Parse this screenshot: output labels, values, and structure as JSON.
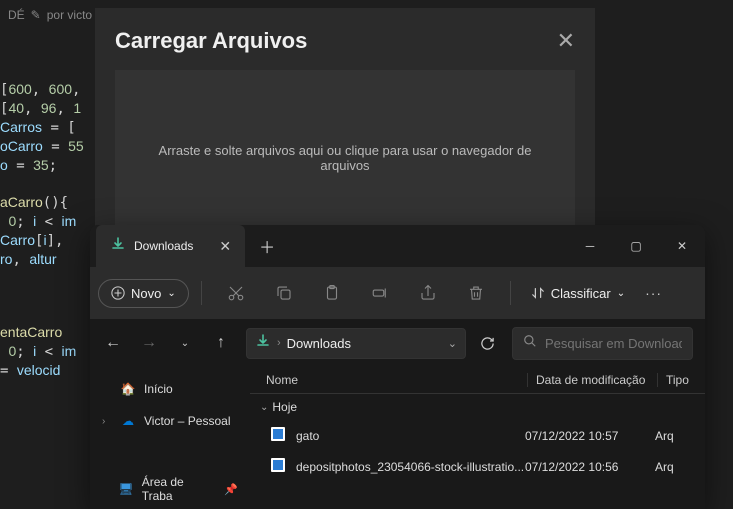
{
  "code_tab": {
    "prefix": "DÉ",
    "by": "por victo"
  },
  "code": "[600, 600, ...\n[40, 96, 1...\nCarros = [...\noCarro = 55...\no = 35;\n\naCarro(){  \n 0; i < im...\nCarro[i],...\nro, altur...\n\n\n\nentaCarro...\n 0; i < im...\n= velocida...",
  "upload": {
    "title": "Carregar Arquivos",
    "drop_text": "Arraste e solte arquivos aqui ou clique para usar o navegador de arquivos"
  },
  "explorer": {
    "tab_label": "Downloads",
    "new_label": "Novo",
    "sort_label": "Classificar",
    "addr_label": "Downloads",
    "search_placeholder": "Pesquisar em Downloads",
    "sidebar": {
      "home": "Início",
      "personal": "Victor – Pessoal",
      "desktop": "Área de Traba"
    },
    "columns": {
      "name": "Nome",
      "date": "Data de modificação",
      "type": "Tipo"
    },
    "group": "Hoje",
    "files": [
      {
        "name": "gato",
        "date": "07/12/2022 10:57",
        "type": "Arq"
      },
      {
        "name": "depositphotos_23054066-stock-illustratio...",
        "date": "07/12/2022 10:56",
        "type": "Arq"
      }
    ]
  }
}
